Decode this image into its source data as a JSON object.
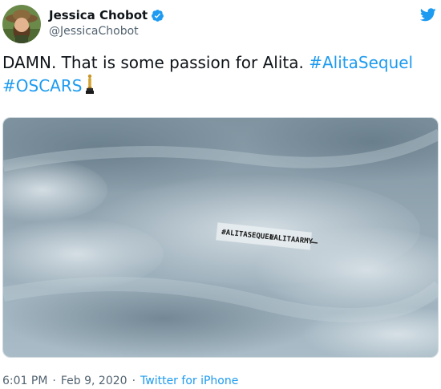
{
  "author": {
    "display_name": "Jessica Chobot",
    "handle": "@JessicaChobot",
    "verified": true
  },
  "tweet": {
    "text_plain": "DAMN. That is some passion for Alita. ",
    "hashtags": [
      "#AlitaSequel",
      "#OSCARS"
    ],
    "emoji": "oscar-statuette-icon"
  },
  "media": {
    "banner_hashtags": [
      "#ALITASEQUEL",
      "#ALITAARMY"
    ]
  },
  "meta": {
    "time": "6:01 PM",
    "date": "Feb 9, 2020",
    "separator": "·",
    "source": "Twitter for iPhone"
  },
  "colors": {
    "link": "#1d9bf0",
    "verified": "#1d9bf0",
    "muted_text": "#536471",
    "primary_text": "#0f1419",
    "sky": "#8fa1ad"
  },
  "icons": {
    "verified": "verified-badge-icon",
    "platform": "twitter-bird-icon",
    "trophy": "oscar-statuette-icon"
  }
}
